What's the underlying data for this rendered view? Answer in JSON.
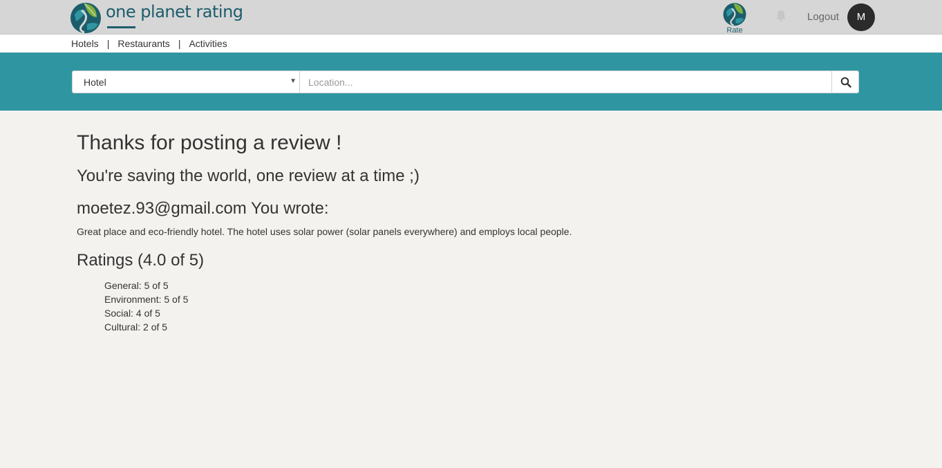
{
  "header": {
    "logo_text": "one planet rating",
    "rate_label": "Rate",
    "logout_label": "Logout",
    "avatar_initial": "M"
  },
  "subnav": {
    "items": [
      "Hotels",
      "Restaurants",
      "Activities"
    ],
    "separator": "|"
  },
  "search": {
    "type_selected": "Hotel",
    "location_placeholder": "Location...",
    "location_value": ""
  },
  "main": {
    "title": "Thanks for posting a review !",
    "subtitle": "You're saving the world, one review at a time ;)",
    "wrote_line": "moetez.93@gmail.com You wrote:",
    "review_text": "Great place and eco-friendly hotel. The hotel uses solar power (solar panels everywhere) and employs local people.",
    "ratings_heading": "Ratings (4.0 of 5)",
    "ratings": [
      "General: 5 of 5",
      "Environment: 5 of 5",
      "Social: 4 of 5",
      "Cultural: 2 of 5"
    ]
  },
  "colors": {
    "header_bg": "#d6d6d6",
    "brand": "#1c5d6b",
    "search_band": "#2f96a1",
    "page_bg": "#f4f2ee",
    "leaf_green": "#7fb03b"
  },
  "icons": {
    "logo": "planet-leaf-icon",
    "rate": "planet-leaf-icon",
    "notifications": "bell-icon",
    "search": "search-icon",
    "select_caret": "caret-down-icon"
  }
}
